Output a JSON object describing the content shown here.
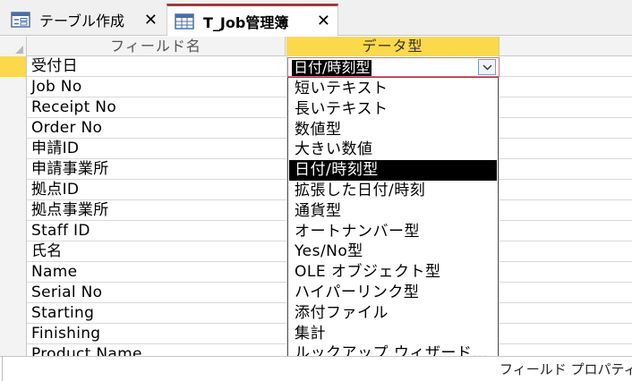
{
  "tabs": [
    {
      "label": "テーブル作成",
      "icon": "form-icon",
      "close": "✕",
      "active": false
    },
    {
      "label": "T_Job管理簿",
      "icon": "table-icon",
      "close": "✕",
      "active": true
    }
  ],
  "grid": {
    "header_field": "フィールド名",
    "header_type": "データ型",
    "rows": [
      "受付日",
      "Job No",
      "Receipt No",
      "Order No",
      "申請ID",
      "申請事業所",
      "拠点ID",
      "拠点事業所",
      "Staff ID",
      "氏名",
      "Name",
      "Serial No",
      "Starting",
      "Finishing",
      "Product Name"
    ],
    "active_row_index": 0,
    "active_type_value": "日付/時刻型"
  },
  "dropdown": {
    "options": [
      "短いテキスト",
      "長いテキスト",
      "数値型",
      "大きい数値",
      "日付/時刻型",
      "拡張した日付/時刻",
      "通貨型",
      "オートナンバー型",
      "Yes/No型",
      "OLE オブジェクト型",
      "ハイパーリンク型",
      "添付ファイル",
      "集計",
      "ルックアップ ウィザード..."
    ],
    "selected_index": 4
  },
  "footer": {
    "field_properties": "フィールド プロパティ"
  },
  "colors": {
    "accent_yellow": "#fbd94a",
    "tab_accent": "#a4373a",
    "combo_border": "#e46b7a"
  }
}
